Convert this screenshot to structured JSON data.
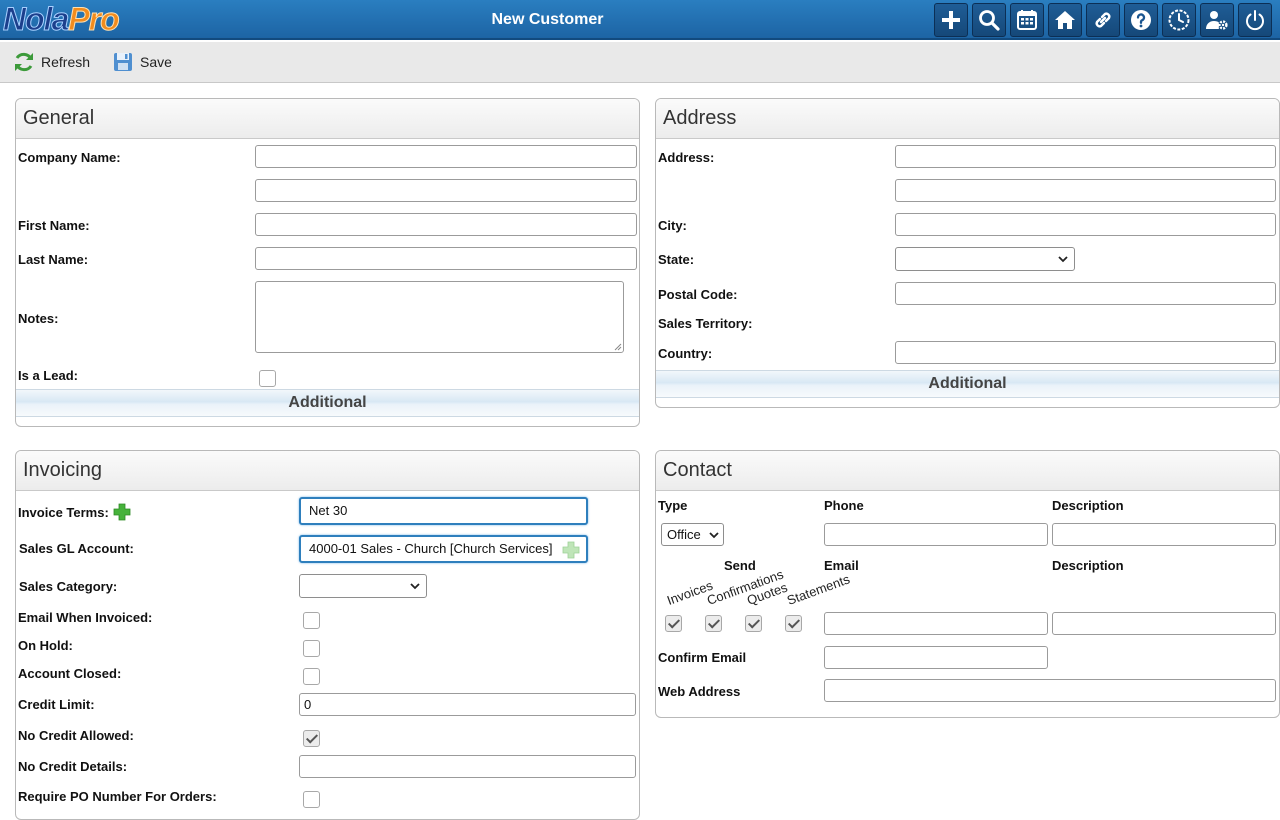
{
  "app": {
    "logo_part1": "Nola",
    "logo_part2": "Pro",
    "title": "New Customer"
  },
  "topbar_icons": [
    "plus-icon",
    "search-icon",
    "calendar-icon",
    "home-icon",
    "link-icon",
    "help-icon",
    "clock-icon",
    "user-settings-icon",
    "power-icon"
  ],
  "toolbar": {
    "refresh_label": "Refresh",
    "save_label": "Save"
  },
  "general": {
    "title": "General",
    "company_name_label": "Company Name:",
    "company_name_value": "",
    "company_name2_value": "",
    "first_name_label": "First Name:",
    "last_name_label": "Last Name:",
    "notes_label": "Notes:",
    "is_lead_label": "Is a Lead:",
    "additional_label": "Additional"
  },
  "address": {
    "title": "Address",
    "address_label": "Address:",
    "city_label": "City:",
    "state_label": "State:",
    "state_value": "",
    "postal_label": "Postal Code:",
    "territory_label": "Sales Territory:",
    "country_label": "Country:",
    "additional_label": "Additional"
  },
  "invoicing": {
    "title": "Invoicing",
    "terms_label": "Invoice Terms:",
    "terms_value": "Net 30",
    "gl_label": "Sales GL Account:",
    "gl_value": "4000-01 Sales - Church [Church Services]",
    "category_label": "Sales Category:",
    "category_value": "",
    "email_invoiced_label": "Email When Invoiced:",
    "on_hold_label": "On Hold:",
    "account_closed_label": "Account Closed:",
    "credit_limit_label": "Credit Limit:",
    "credit_limit_value": "0",
    "no_credit_label": "No Credit Allowed:",
    "no_credit_details_label": "No Credit Details:",
    "require_po_label": "Require PO Number For Orders:"
  },
  "contact": {
    "title": "Contact",
    "type_header": "Type",
    "phone_header": "Phone",
    "description_header": "Description",
    "type_value": "Office",
    "send_header": "Send",
    "email_header": "Email",
    "email_description_header": "Description",
    "send_options": [
      "Invoices",
      "Confirmations",
      "Quotes",
      "Statements"
    ],
    "confirm_email_label": "Confirm Email",
    "web_address_label": "Web Address"
  }
}
